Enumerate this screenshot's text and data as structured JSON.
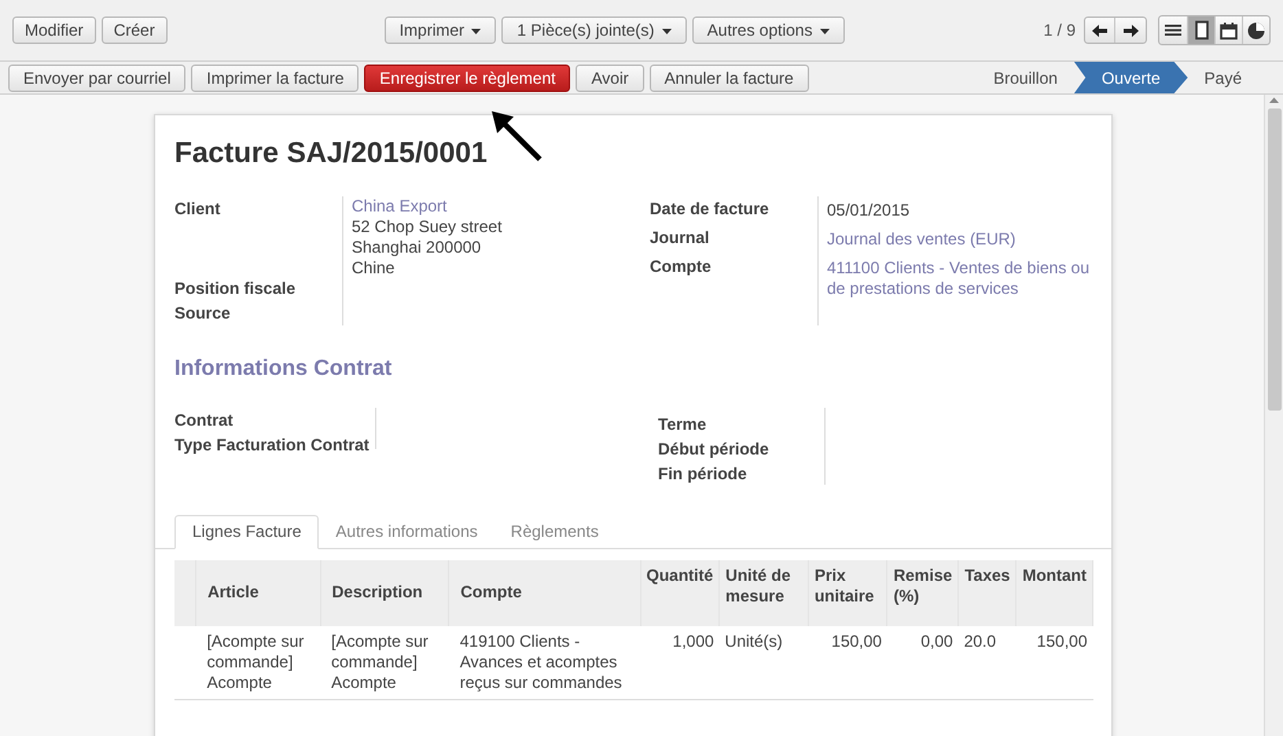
{
  "toolbar": {
    "left_buttons": [
      "Modifier",
      "Créer"
    ],
    "dropdowns": [
      "Imprimer",
      "1 Pièce(s) jointe(s)",
      "Autres options"
    ],
    "pager": "1 / 9",
    "views": [
      {
        "kind": "list",
        "selected": false
      },
      {
        "kind": "form",
        "selected": true
      },
      {
        "kind": "calendar",
        "selected": false
      },
      {
        "kind": "graph",
        "selected": false
      }
    ]
  },
  "actions": [
    {
      "label": "Envoyer par courriel",
      "primary": false
    },
    {
      "label": "Imprimer la facture",
      "primary": false
    },
    {
      "label": "Enregistrer le règlement",
      "primary": true
    },
    {
      "label": "Avoir",
      "primary": false
    },
    {
      "label": "Annuler la facture",
      "primary": false
    }
  ],
  "statusbar": [
    {
      "label": "Brouillon",
      "selected": false
    },
    {
      "label": "Ouverte",
      "selected": true
    },
    {
      "label": "Payé",
      "selected": false
    }
  ],
  "title": "Facture SAJ/2015/0001",
  "left_fields": [
    {
      "label": "Client",
      "lines": [
        {
          "text": "China Export",
          "link": true
        },
        {
          "text": "52 Chop Suey street",
          "link": false
        },
        {
          "text": "Shanghai 200000",
          "link": false
        },
        {
          "text": "Chine",
          "link": false
        }
      ]
    },
    {
      "label": "Position fiscale"
    },
    {
      "label": "Source"
    }
  ],
  "right_fields": [
    {
      "label": "Date de facture",
      "value": "05/01/2015",
      "link": false
    },
    {
      "label": "Journal",
      "value": "Journal des ventes (EUR)",
      "link": true
    },
    {
      "label": "Compte",
      "value": "411100 Clients - Ventes de biens ou de prestations de services",
      "link": true
    }
  ],
  "section_title": "Informations Contrat",
  "contract_left": [
    "Contrat",
    "Type Facturation Contrat"
  ],
  "contract_right": [
    "Terme",
    "Début période",
    "Fin période"
  ],
  "tabs": [
    {
      "label": "Lignes Facture",
      "selected": true
    },
    {
      "label": "Autres informations",
      "selected": false
    },
    {
      "label": "Règlements",
      "selected": false
    }
  ],
  "table": {
    "columns": [
      "Article",
      "Description",
      "Compte",
      "Quantité",
      "Unité de mesure",
      "Prix unitaire",
      "Remise (%)",
      "Taxes",
      "Montant"
    ],
    "rows": [
      [
        "[Acompte sur commande] Acompte",
        "[Acompte sur commande] Acompte",
        "419100 Clients - Avances et acomptes reçus sur commandes",
        "1,000",
        "Unité(s)",
        "150,00",
        "0,00",
        "20.0",
        "150,00"
      ]
    ]
  }
}
